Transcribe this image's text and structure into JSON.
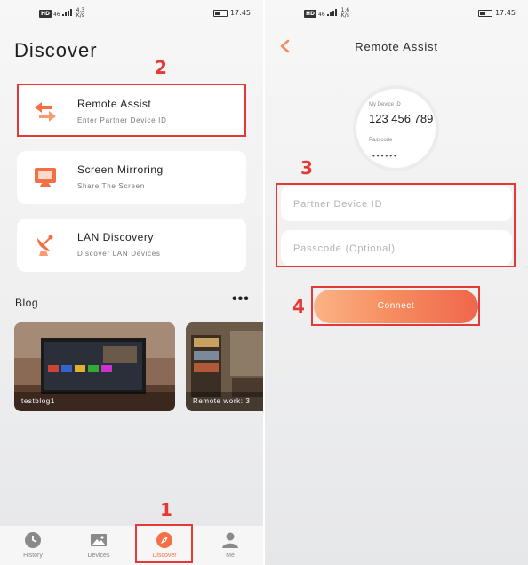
{
  "status_bar": {
    "network": "HD",
    "signal": "46",
    "speed_left": "4.3",
    "speed_right": "1.6",
    "speed_unit": "K/s",
    "time": "17:45"
  },
  "discover": {
    "title": "Discover",
    "cards": [
      {
        "title": "Remote Assist",
        "subtitle": "Enter Partner Device ID",
        "icon": "swap-arrows-icon"
      },
      {
        "title": "Screen Mirroring",
        "subtitle": "Share The Screen",
        "icon": "screen-cast-icon"
      },
      {
        "title": "LAN Discovery",
        "subtitle": "Discover LAN Devices",
        "icon": "satellite-dish-icon"
      }
    ],
    "blog": {
      "heading": "Blog",
      "more": "•••",
      "posts": [
        {
          "caption": "testblog1"
        },
        {
          "caption": "Remote work: 3"
        }
      ]
    }
  },
  "tabbar": {
    "tabs": [
      {
        "label": "History",
        "icon": "clock-icon"
      },
      {
        "label": "Devices",
        "icon": "image-icon"
      },
      {
        "label": "Discover",
        "icon": "compass-icon",
        "active": true
      },
      {
        "label": "Me",
        "icon": "person-icon"
      }
    ]
  },
  "remote_assist": {
    "title": "Remote Assist",
    "device_id_label": "My Device ID",
    "device_id": "123 456 789",
    "passcode_label": "Passcode",
    "passcode_mask": "••••••",
    "partner_placeholder": "Partner Device ID",
    "passcode_placeholder": "Passcode (Optional)",
    "connect_label": "Connect"
  },
  "annotations": {
    "n1": "1",
    "n2": "2",
    "n3": "3",
    "n4": "4"
  },
  "colors": {
    "accent": "#f36f44",
    "highlight": "#e53935",
    "card_bg": "#ffffff"
  }
}
